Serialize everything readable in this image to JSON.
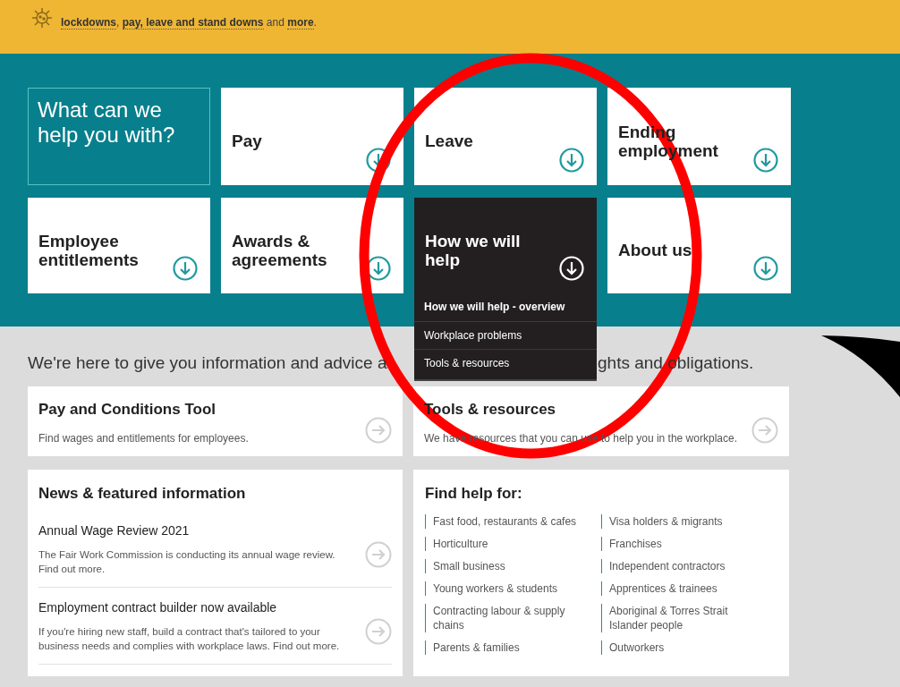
{
  "banner": {
    "segments": [
      {
        "text": "lockdowns",
        "link": true
      },
      {
        "text": ", ",
        "link": false
      },
      {
        "text": "pay, leave and stand downs",
        "link": true
      },
      {
        "text": " and ",
        "link": false
      },
      {
        "text": "more",
        "link": true
      },
      {
        "text": ".",
        "link": false
      }
    ]
  },
  "hero": {
    "heading": "What can we help you with?",
    "tiles": [
      {
        "label": "Pay",
        "expanded": false
      },
      {
        "label": "Leave",
        "expanded": false
      },
      {
        "label": "Ending employment",
        "expanded": false
      },
      {
        "label": "Employee entitlements",
        "expanded": false
      },
      {
        "label": "Awards & agreements",
        "expanded": false
      },
      {
        "label": "How we will help",
        "expanded": true,
        "menu": [
          {
            "label": "How we will help - overview",
            "kind": "overview"
          },
          {
            "label": "Workplace problems",
            "kind": "link"
          },
          {
            "label": "Tools & resources",
            "kind": "link"
          }
        ]
      },
      {
        "label": "About us",
        "expanded": false
      }
    ]
  },
  "intro": [
    "We're here to give you information and advice a",
    "ghts and obligations."
  ],
  "cards": [
    {
      "title": "Pay and Conditions Tool",
      "description": "Find wages and entitlements for employees."
    },
    {
      "title": "Tools & resources",
      "description": "We have resources that you can use to help you in the workplace."
    }
  ],
  "news": {
    "heading": "News & featured information",
    "items": [
      {
        "title": "Annual Wage Review 2021",
        "description": "The Fair Work Commission is conducting its annual wage review. Find out more."
      },
      {
        "title": "Employment contract builder now available",
        "description": "If you're hiring new staff, build a contract that's tailored to your business needs and complies with workplace laws. Find out more."
      }
    ]
  },
  "find_help": {
    "heading": "Find help for:",
    "items": [
      "Fast food, restaurants & cafes",
      "Visa holders & migrants",
      "Horticulture",
      "Franchises",
      "Small business",
      "Independent contractors",
      "Young workers & students",
      "Apprentices & trainees",
      "Contracting labour & supply chains",
      "Aboriginal & Torres Strait Islander people",
      "Parents & families",
      "Outworkers"
    ]
  }
}
